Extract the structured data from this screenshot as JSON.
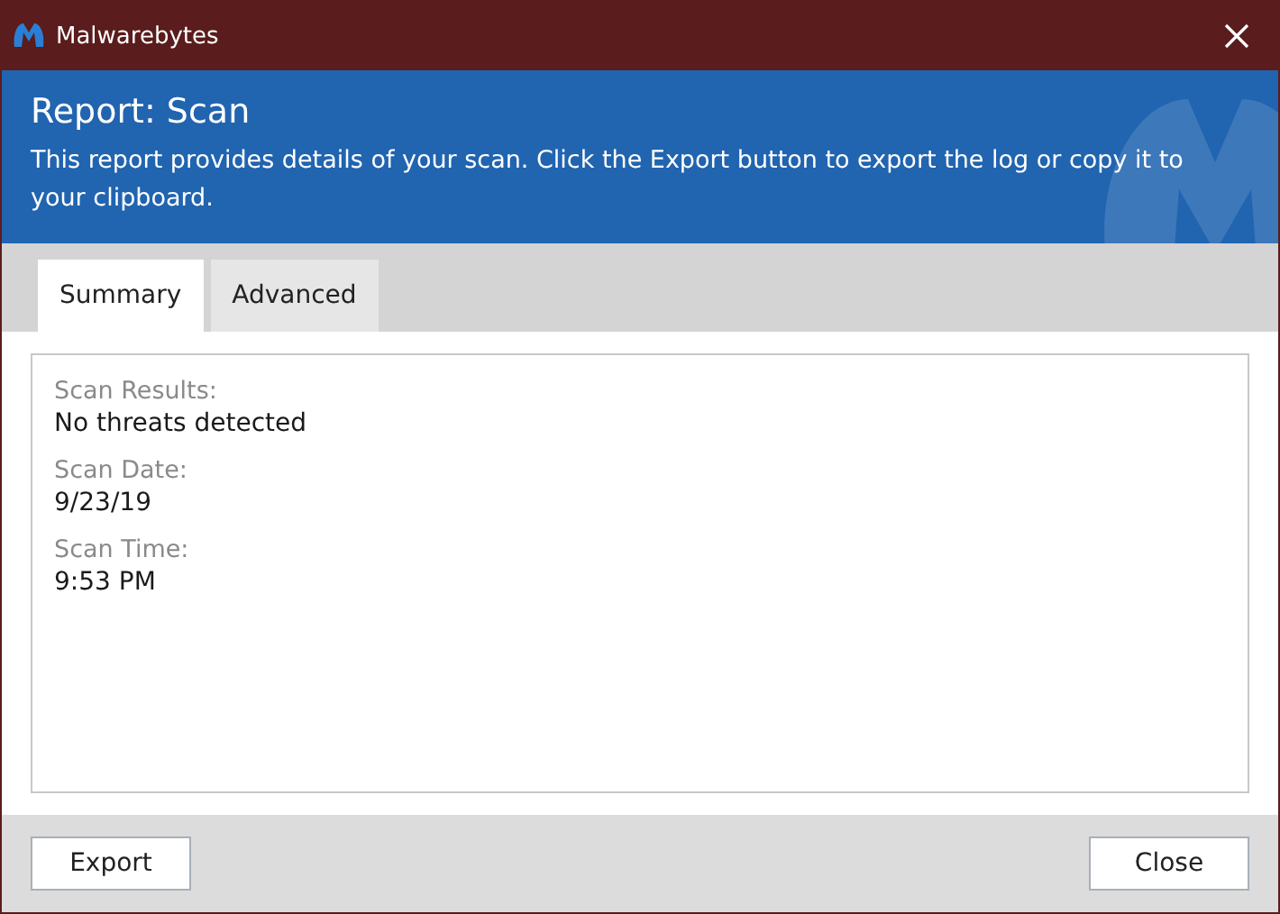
{
  "window": {
    "title": "Malwarebytes"
  },
  "header": {
    "title": "Report: Scan",
    "description": "This report provides details of your scan. Click the Export button to export the log or copy it to your clipboard."
  },
  "tabs": [
    {
      "label": "Summary",
      "selected": true
    },
    {
      "label": "Advanced",
      "selected": false
    }
  ],
  "summary": [
    {
      "label": "Scan Results:",
      "value": "No threats detected"
    },
    {
      "label": "Scan Date:",
      "value": "9/23/19"
    },
    {
      "label": "Scan Time:",
      "value": "9:53 PM"
    }
  ],
  "buttons": [
    {
      "label": "Export"
    },
    {
      "label": "Close"
    }
  ]
}
